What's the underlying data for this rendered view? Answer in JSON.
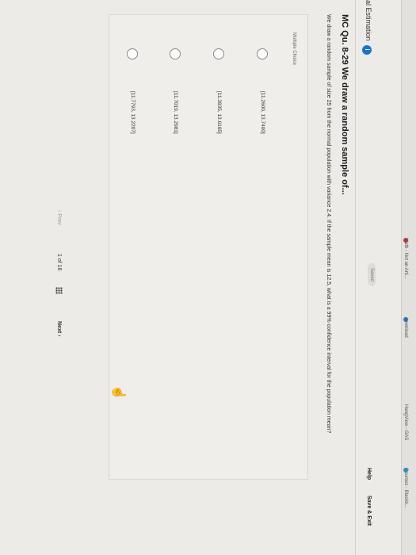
{
  "bookmarks": [
    "Math - Not an Arti...",
    "download",
    "HangView - GAS",
    "Courses - Blackb..."
  ],
  "header": {
    "section_title": "al Estimation",
    "info_label": "i",
    "saved_label": "Saved",
    "help_label": "Help",
    "save_exit_label": "Save & Exit"
  },
  "question": {
    "title": "MC Qu. 8-29 We draw a random sample of...",
    "text": "We draw a random sample of size 25 from the normal population with variance 2.4. If the sample mean is 12.5, what is a 99% confidence interval for the population mean?",
    "type_label": "Multiple Choice",
    "options": [
      "[11.2600, 13.7400]",
      "[11.3835, 13.6165]",
      "[11.7019, 13.2981]",
      "[11.7793, 13.2207]"
    ]
  },
  "pager": {
    "prev_label": "‹ Prev",
    "page": "1",
    "of": "of",
    "total": "16",
    "next_label": "Next ›"
  },
  "colors": {
    "info_icon": "#1a73c7",
    "page_bg": "#ecebe8"
  }
}
